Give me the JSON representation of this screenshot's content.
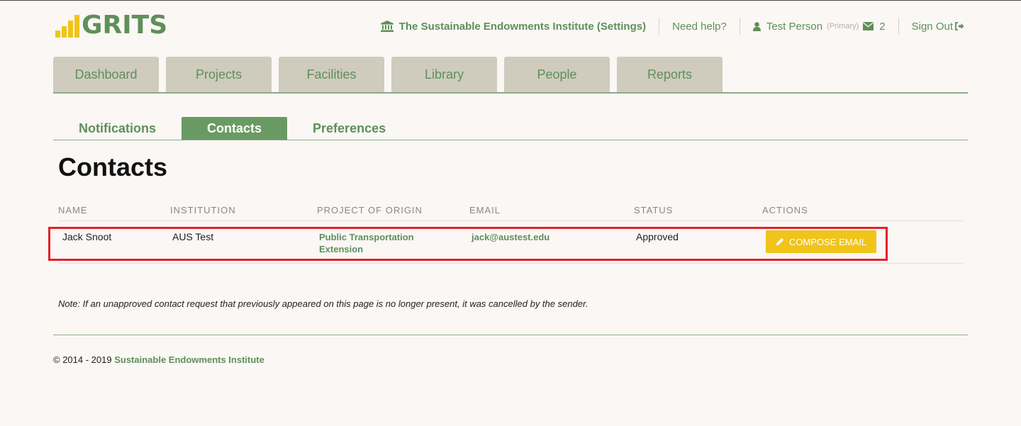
{
  "brand": {
    "name": "GRITS",
    "bar_color": "#f0c419",
    "text_color": "#5f8f5a"
  },
  "topnav": {
    "org": "The Sustainable Endowments Institute (Settings)",
    "help": "Need help?",
    "user": "Test Person",
    "user_role": "(Primary)",
    "message_count": "2",
    "sign_out": "Sign Out"
  },
  "main_tabs": [
    "Dashboard",
    "Projects",
    "Facilities",
    "Library",
    "People",
    "Reports"
  ],
  "sub_tabs": [
    "Notifications",
    "Contacts",
    "Preferences"
  ],
  "active_sub_tab": "Contacts",
  "page_title": "Contacts",
  "table": {
    "headers": [
      "NAME",
      "INSTITUTION",
      "PROJECT OF ORIGIN",
      "EMAIL",
      "STATUS",
      "ACTIONS"
    ],
    "rows": [
      {
        "name": "Jack Snoot",
        "institution": "AUS Test",
        "project": "Public Transportation Extension",
        "email": "jack@austest.edu",
        "status": "Approved",
        "action": "COMPOSE EMAIL"
      }
    ]
  },
  "note": "Note: If an unapproved contact request that previously appeared on this page is no longer present, it was cancelled by the sender.",
  "footer": {
    "copyright": "© 2014 - 2019",
    "org_link": "Sustainable Endowments Institute"
  },
  "colors": {
    "accent": "#5f8f5a",
    "tab_bg": "#cfcbbd",
    "button": "#f0c419",
    "highlight": "#e5202b",
    "background": "#faf7f4"
  }
}
